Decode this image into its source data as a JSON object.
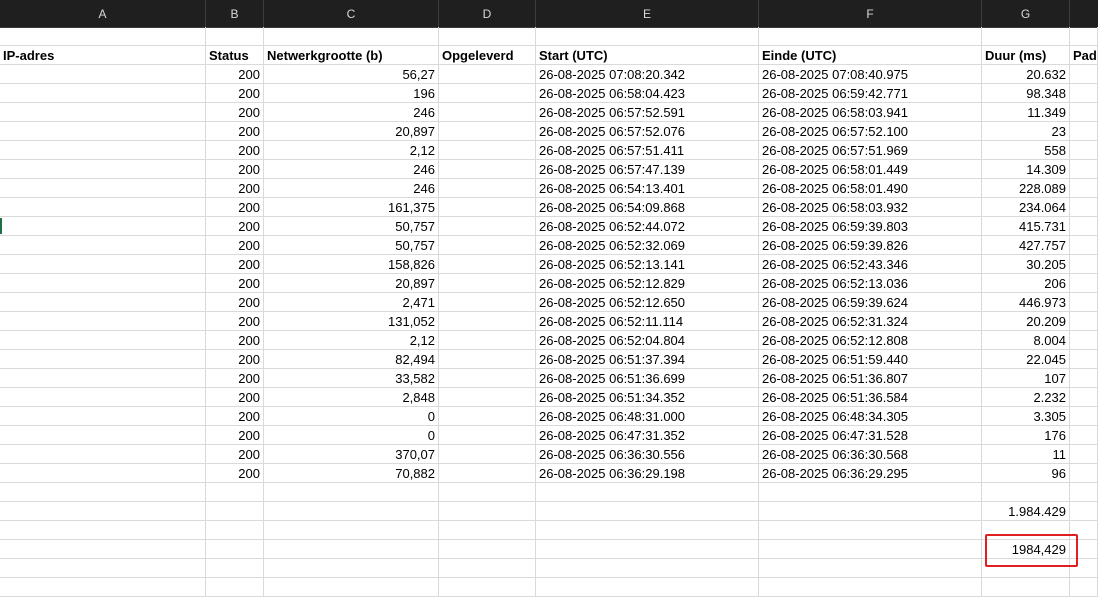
{
  "column_headers": [
    "A",
    "B",
    "C",
    "D",
    "E",
    "F",
    "G"
  ],
  "table_headers": {
    "a": "IP-adres",
    "b": "Status",
    "c": "Netwerkgrootte (b)",
    "d": "Opgeleverd",
    "e": "Start (UTC)",
    "f": "Einde (UTC)",
    "g": "Duur (ms)",
    "h": "Pad"
  },
  "rows": [
    {
      "status": "200",
      "size": "56,27",
      "start": "26-08-2025 07:08:20.342",
      "end": "26-08-2025 07:08:40.975",
      "dur": "20.632"
    },
    {
      "status": "200",
      "size": "196",
      "start": "26-08-2025 06:58:04.423",
      "end": "26-08-2025 06:59:42.771",
      "dur": "98.348"
    },
    {
      "status": "200",
      "size": "246",
      "start": "26-08-2025 06:57:52.591",
      "end": "26-08-2025 06:58:03.941",
      "dur": "11.349"
    },
    {
      "status": "200",
      "size": "20,897",
      "start": "26-08-2025 06:57:52.076",
      "end": "26-08-2025 06:57:52.100",
      "dur": "23"
    },
    {
      "status": "200",
      "size": "2,12",
      "start": "26-08-2025 06:57:51.411",
      "end": "26-08-2025 06:57:51.969",
      "dur": "558"
    },
    {
      "status": "200",
      "size": "246",
      "start": "26-08-2025 06:57:47.139",
      "end": "26-08-2025 06:58:01.449",
      "dur": "14.309"
    },
    {
      "status": "200",
      "size": "246",
      "start": "26-08-2025 06:54:13.401",
      "end": "26-08-2025 06:58:01.490",
      "dur": "228.089"
    },
    {
      "status": "200",
      "size": "161,375",
      "start": "26-08-2025 06:54:09.868",
      "end": "26-08-2025 06:58:03.932",
      "dur": "234.064"
    },
    {
      "status": "200",
      "size": "50,757",
      "start": "26-08-2025 06:52:44.072",
      "end": "26-08-2025 06:59:39.803",
      "dur": "415.731"
    },
    {
      "status": "200",
      "size": "50,757",
      "start": "26-08-2025 06:52:32.069",
      "end": "26-08-2025 06:59:39.826",
      "dur": "427.757"
    },
    {
      "status": "200",
      "size": "158,826",
      "start": "26-08-2025 06:52:13.141",
      "end": "26-08-2025 06:52:43.346",
      "dur": "30.205"
    },
    {
      "status": "200",
      "size": "20,897",
      "start": "26-08-2025 06:52:12.829",
      "end": "26-08-2025 06:52:13.036",
      "dur": "206"
    },
    {
      "status": "200",
      "size": "2,471",
      "start": "26-08-2025 06:52:12.650",
      "end": "26-08-2025 06:59:39.624",
      "dur": "446.973"
    },
    {
      "status": "200",
      "size": "131,052",
      "start": "26-08-2025 06:52:11.114",
      "end": "26-08-2025 06:52:31.324",
      "dur": "20.209"
    },
    {
      "status": "200",
      "size": "2,12",
      "start": "26-08-2025 06:52:04.804",
      "end": "26-08-2025 06:52:12.808",
      "dur": "8.004"
    },
    {
      "status": "200",
      "size": "82,494",
      "start": "26-08-2025 06:51:37.394",
      "end": "26-08-2025 06:51:59.440",
      "dur": "22.045"
    },
    {
      "status": "200",
      "size": "33,582",
      "start": "26-08-2025 06:51:36.699",
      "end": "26-08-2025 06:51:36.807",
      "dur": "107"
    },
    {
      "status": "200",
      "size": "2,848",
      "start": "26-08-2025 06:51:34.352",
      "end": "26-08-2025 06:51:36.584",
      "dur": "2.232"
    },
    {
      "status": "200",
      "size": "0",
      "start": "26-08-2025 06:48:31.000",
      "end": "26-08-2025 06:48:34.305",
      "dur": "3.305"
    },
    {
      "status": "200",
      "size": "0",
      "start": "26-08-2025 06:47:31.352",
      "end": "26-08-2025 06:47:31.528",
      "dur": "176"
    },
    {
      "status": "200",
      "size": "370,07",
      "start": "26-08-2025 06:36:30.556",
      "end": "26-08-2025 06:36:30.568",
      "dur": "11"
    },
    {
      "status": "200",
      "size": "70,882",
      "start": "26-08-2025 06:36:29.198",
      "end": "26-08-2025 06:36:29.295",
      "dur": "96"
    }
  ],
  "totals": {
    "sum_dot": "1.984.429",
    "sum_comma": "1984,429"
  },
  "colors": {
    "header_bg": "#1f1f1f",
    "highlight_border": "#e02020",
    "grid_line": "#dadada"
  }
}
